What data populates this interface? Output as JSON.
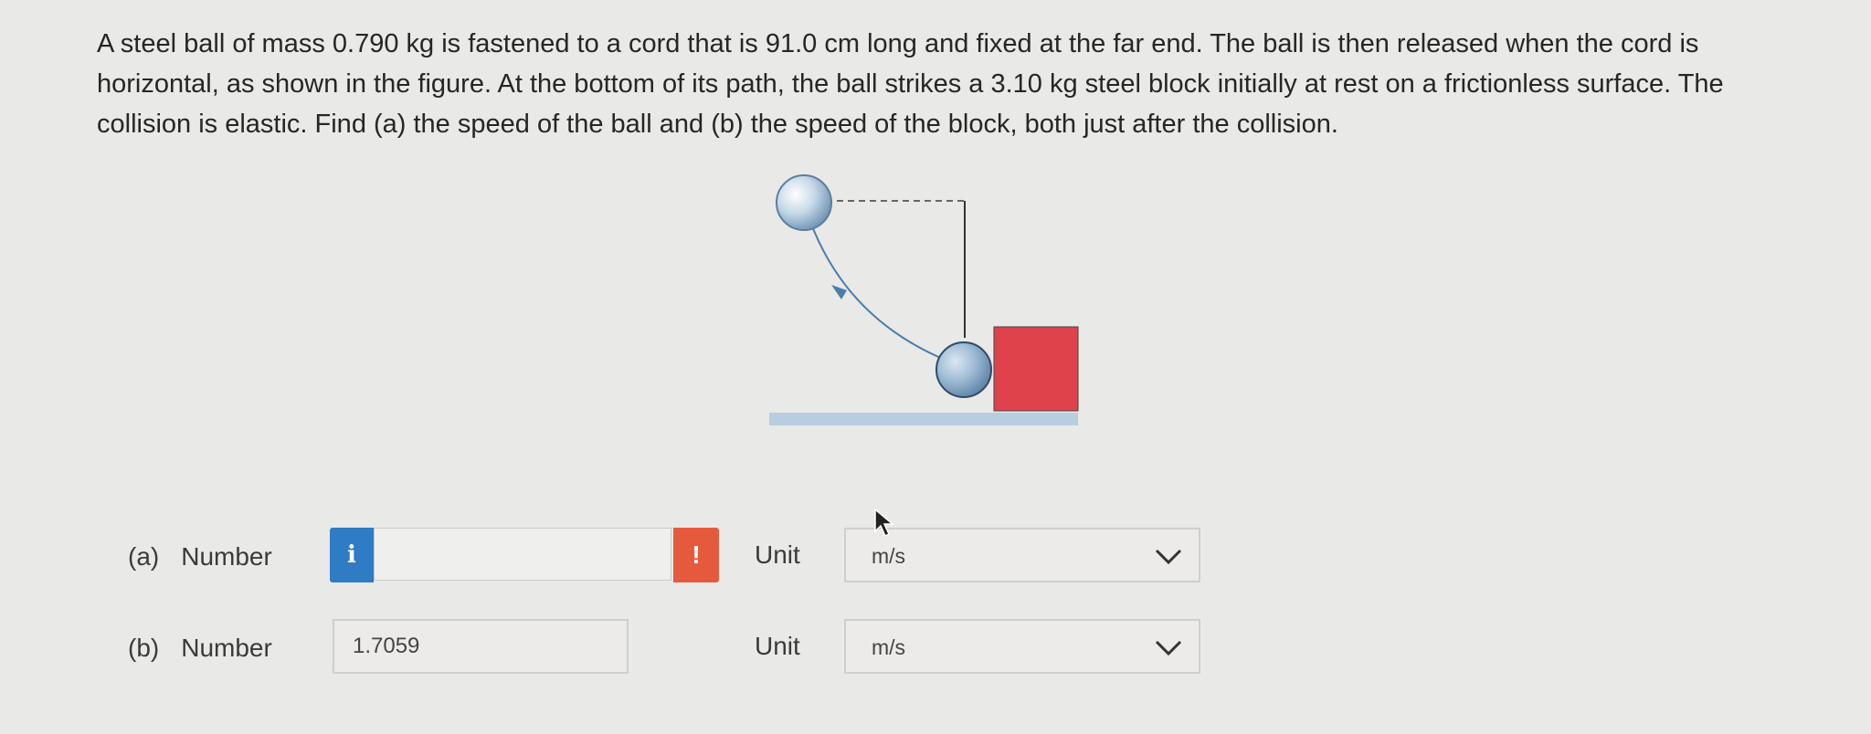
{
  "problem": {
    "text": "A steel ball of mass 0.790 kg is fastened to a cord that is 91.0 cm long and fixed at the far end. The ball is then released when the cord is horizontal, as shown in the figure. At the bottom of its path, the ball strikes a 3.10 kg steel block initially at rest on a frictionless surface. The collision is elastic. Find (a) the speed of the ball and (b) the speed of the block, both just after the collision."
  },
  "parts": [
    {
      "letter": "(a)",
      "number_label": "Number",
      "value": "",
      "info_icon": "i",
      "alert_icon": "!",
      "unit_label": "Unit",
      "unit_value": "m/s"
    },
    {
      "letter": "(b)",
      "number_label": "Number",
      "value": "1.7059",
      "unit_label": "Unit",
      "unit_value": "m/s"
    }
  ],
  "colors": {
    "info": "#2f7cc4",
    "alert": "#e55a3c",
    "block": "#e0424b",
    "ball": "#9fbcd6",
    "floor": "#b8cde0"
  }
}
